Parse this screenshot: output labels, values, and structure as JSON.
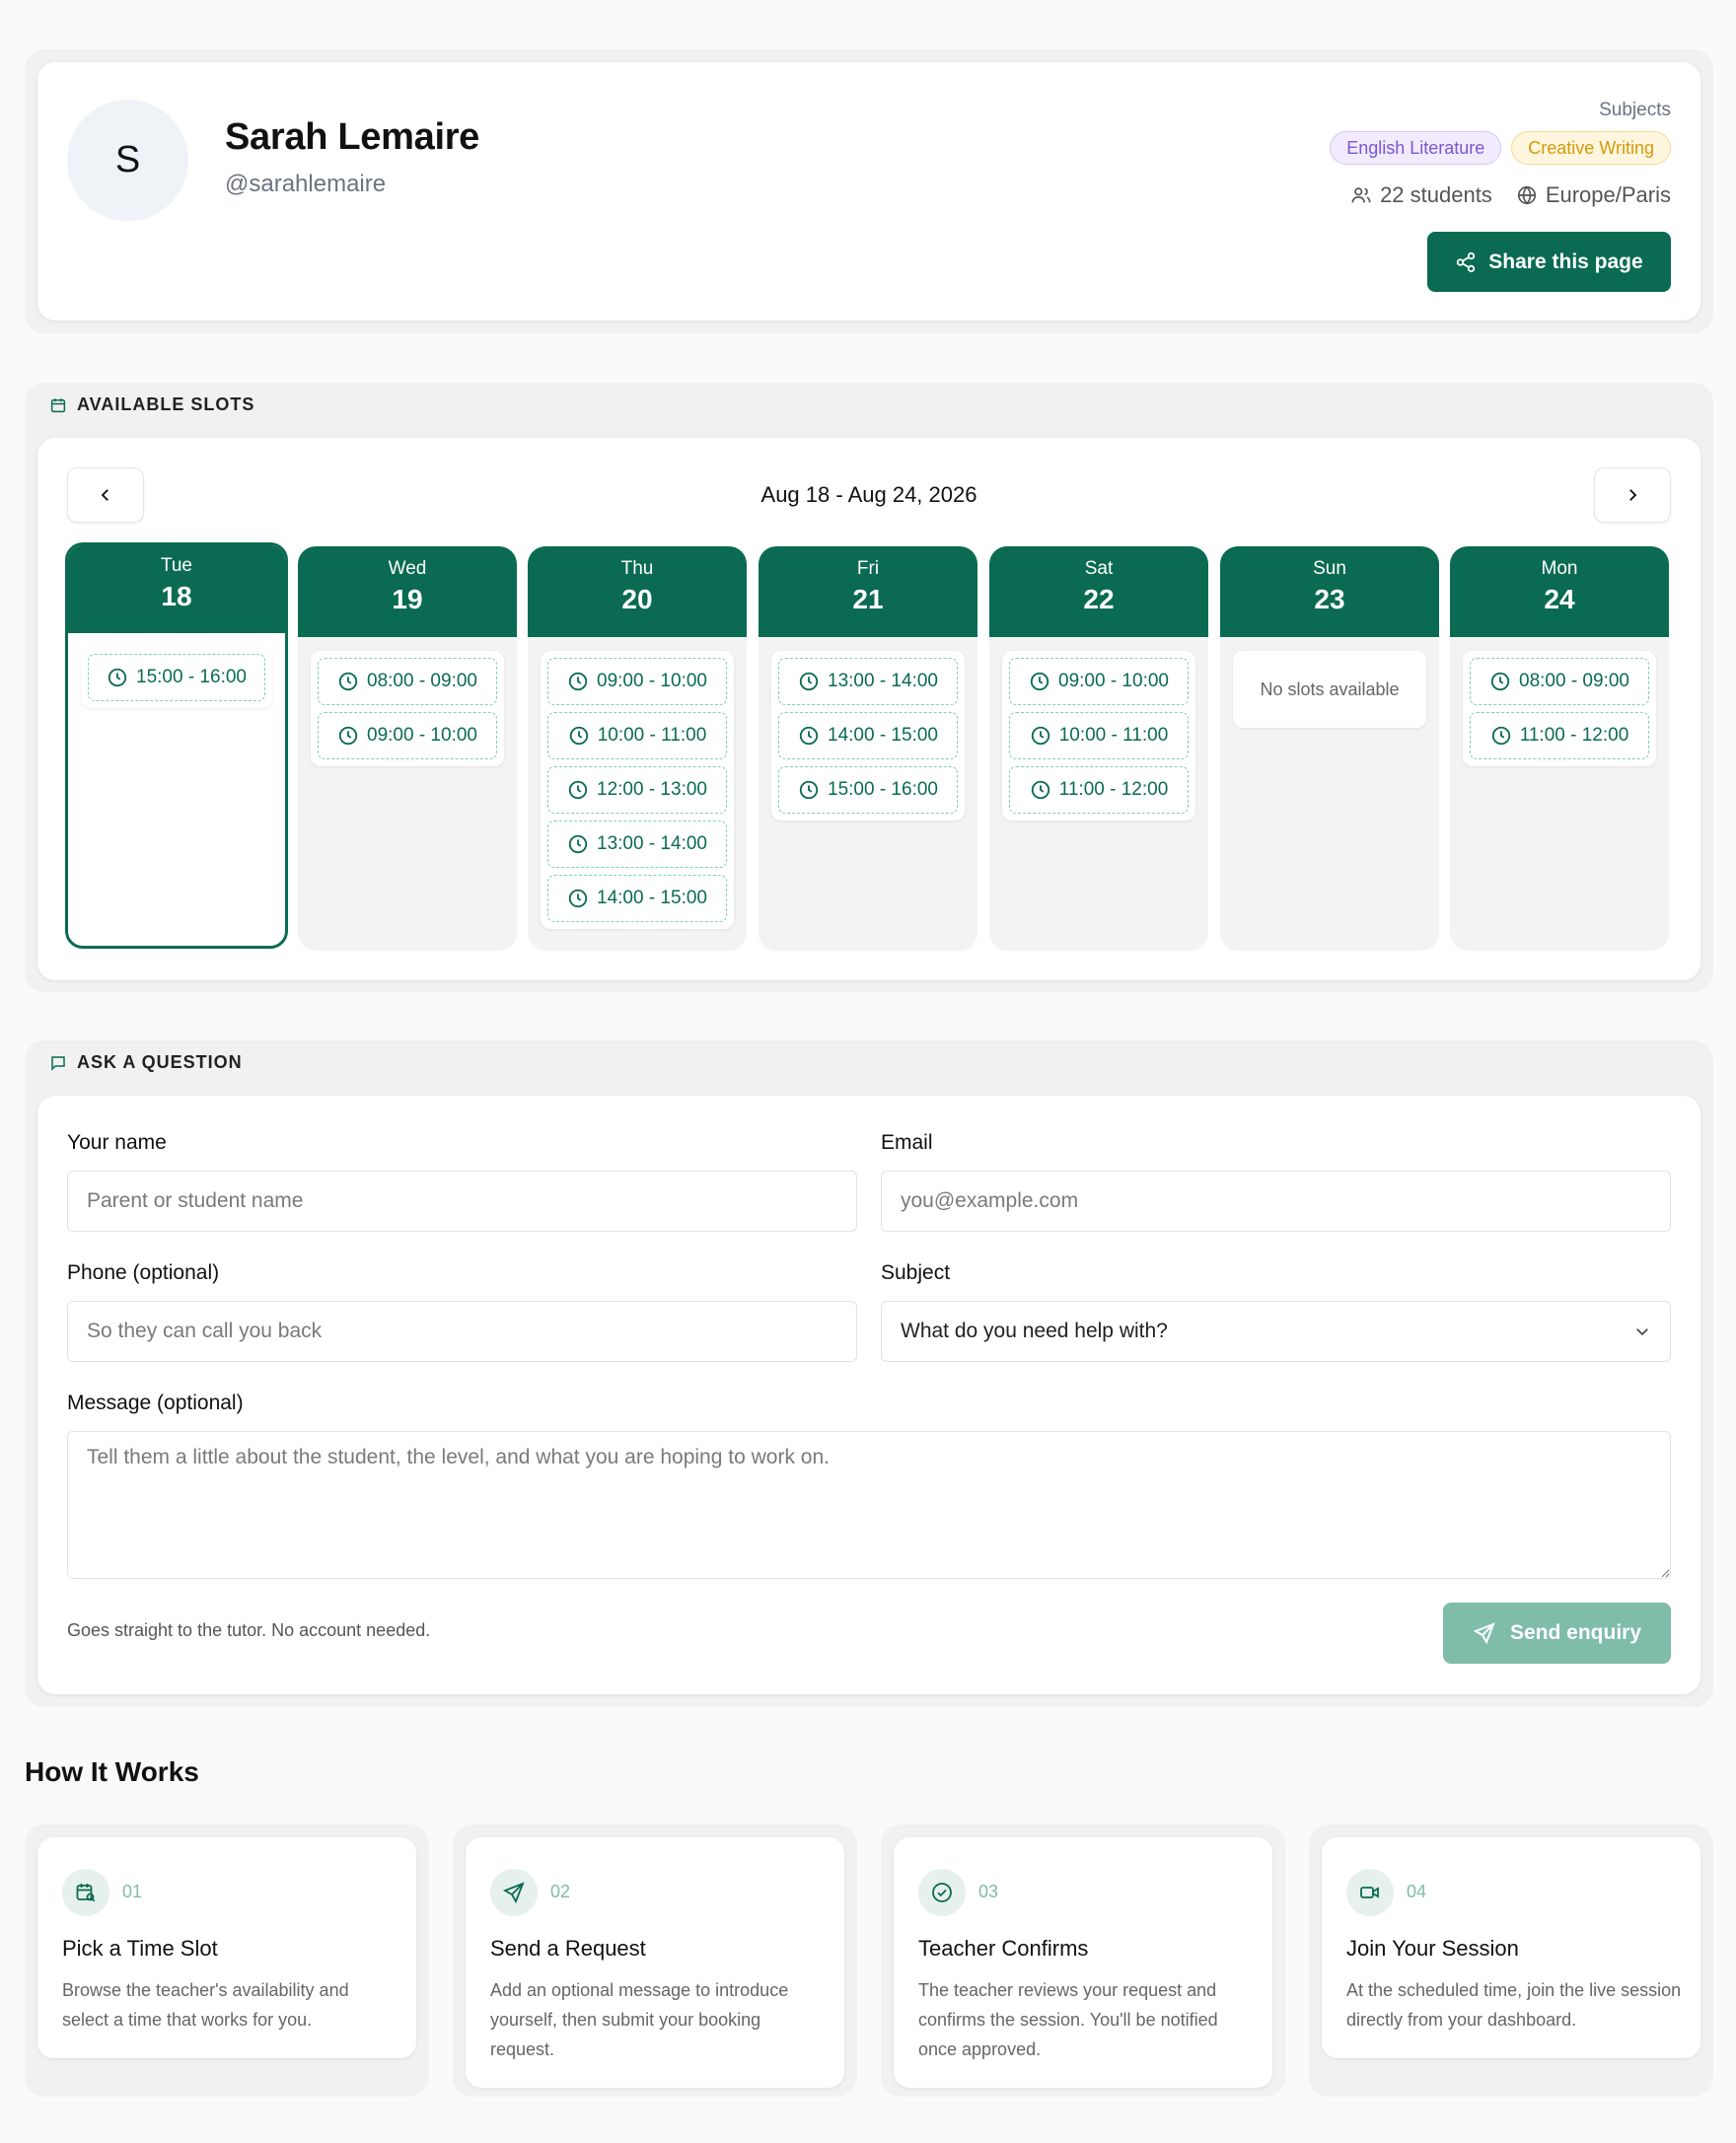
{
  "profile": {
    "initial": "S",
    "name": "Sarah Lemaire",
    "handle": "@sarahlemaire",
    "subjects_label": "Subjects",
    "subjects": [
      "English Literature",
      "Creative Writing"
    ],
    "students": "22 students",
    "timezone": "Europe/Paris",
    "share_label": "Share this page"
  },
  "slots": {
    "section_title": "AVAILABLE SLOTS",
    "week_range": "Aug 18 - Aug 24, 2026",
    "no_slots_text": "No slots available",
    "days": [
      {
        "dow": "Tue",
        "num": "18",
        "selected": true,
        "slots": [
          "15:00 - 16:00"
        ]
      },
      {
        "dow": "Wed",
        "num": "19",
        "slots": [
          "08:00 - 09:00",
          "09:00 - 10:00"
        ]
      },
      {
        "dow": "Thu",
        "num": "20",
        "slots": [
          "09:00 - 10:00",
          "10:00 - 11:00",
          "12:00 - 13:00",
          "13:00 - 14:00",
          "14:00 - 15:00"
        ]
      },
      {
        "dow": "Fri",
        "num": "21",
        "slots": [
          "13:00 - 14:00",
          "14:00 - 15:00",
          "15:00 - 16:00"
        ]
      },
      {
        "dow": "Sat",
        "num": "22",
        "slots": [
          "09:00 - 10:00",
          "10:00 - 11:00",
          "11:00 - 12:00"
        ]
      },
      {
        "dow": "Sun",
        "num": "23",
        "slots": []
      },
      {
        "dow": "Mon",
        "num": "24",
        "slots": [
          "08:00 - 09:00",
          "11:00 - 12:00"
        ]
      }
    ]
  },
  "question": {
    "section_title": "ASK A QUESTION",
    "name_label": "Your name",
    "name_placeholder": "Parent or student name",
    "email_label": "Email",
    "email_placeholder": "you@example.com",
    "phone_label": "Phone (optional)",
    "phone_placeholder": "So they can call you back",
    "subject_label": "Subject",
    "subject_value": "What do you need help with?",
    "message_label": "Message (optional)",
    "message_placeholder": "Tell them a little about the student, the level, and what you are hoping to work on.",
    "note": "Goes straight to the tutor. No account needed.",
    "send_label": "Send enquiry"
  },
  "how_it_works": {
    "title": "How It Works",
    "steps": [
      {
        "num": "01",
        "title": "Pick a Time Slot",
        "desc": "Browse the teacher's availability and select a time that works for you.",
        "icon": "calendar-search-icon"
      },
      {
        "num": "02",
        "title": "Send a Request",
        "desc": "Add an optional message to introduce yourself, then submit your booking request.",
        "icon": "send-icon"
      },
      {
        "num": "03",
        "title": "Teacher Confirms",
        "desc": "The teacher reviews your request and confirms the session. You'll be notified once approved.",
        "icon": "check-circle-icon"
      },
      {
        "num": "04",
        "title": "Join Your Session",
        "desc": "At the scheduled time, join the live session directly from your dashboard.",
        "icon": "video-icon"
      }
    ]
  },
  "colors": {
    "primary": "#0a6b52",
    "slot_border": "#7fd1b4",
    "send_disabled": "#7fbcaa",
    "badge_purple": "#7c56d0",
    "badge_amber": "#d49a06"
  }
}
